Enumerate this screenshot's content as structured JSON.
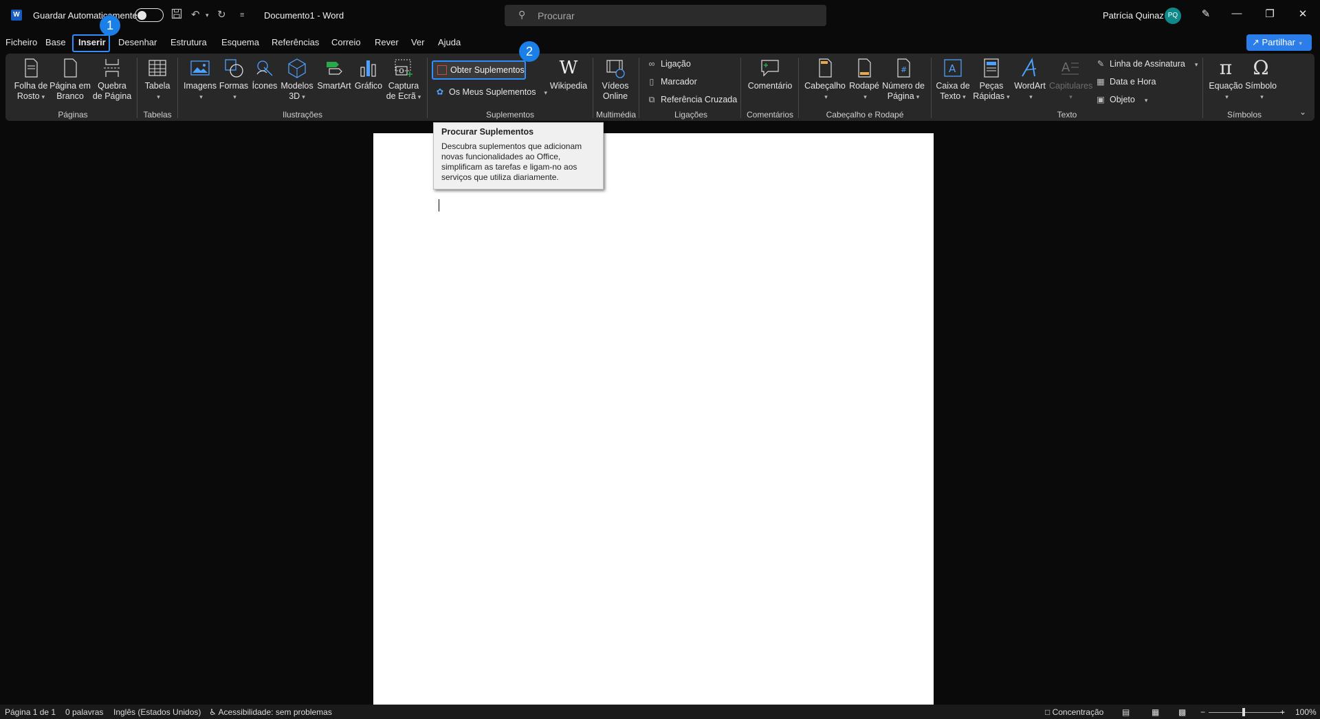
{
  "titlebar": {
    "autosave_label": "Guardar Automaticamente",
    "doc_title": "Documento1  -  Word",
    "search_placeholder": "Procurar",
    "user_name": "Patrícia Quinaz",
    "user_initials": "PQ",
    "app_badge": "W"
  },
  "tabs": [
    "Ficheiro",
    "Base",
    "Inserir",
    "Desenhar",
    "Estrutura",
    "Esquema",
    "Referências",
    "Correio",
    "Rever",
    "Ver",
    "Ajuda"
  ],
  "active_tab": "Inserir",
  "share_label": "Partilhar",
  "steps": [
    "1",
    "2"
  ],
  "ribbon": {
    "paginas": {
      "label": "Páginas",
      "folha1": "Folha de",
      "folha2": "Rosto",
      "branco1": "Página em",
      "branco2": "Branco",
      "quebra1": "Quebra",
      "quebra2": "de Página"
    },
    "tabelas": {
      "label": "Tabelas",
      "tabela": "Tabela"
    },
    "ilustracoes": {
      "label": "Ilustrações",
      "imagens": "Imagens",
      "formas": "Formas",
      "icones": "Ícones",
      "modelos1": "Modelos",
      "modelos2": "3D",
      "smartart": "SmartArt",
      "grafico": "Gráfico",
      "captura1": "Captura",
      "captura2": "de Ecrã"
    },
    "suplementos": {
      "label": "Suplementos",
      "obter": "Obter Suplementos",
      "meus": "Os Meus Suplementos",
      "wikipedia": "Wikipedia"
    },
    "multimedia": {
      "label": "Multimédia",
      "videos1": "Vídeos",
      "videos2": "Online"
    },
    "ligacoes": {
      "label": "Ligações",
      "ligacao": "Ligação",
      "marcador": "Marcador",
      "referencia": "Referência Cruzada"
    },
    "comentarios": {
      "label": "Comentários",
      "comentario": "Comentário"
    },
    "cabecalho_rodape": {
      "label": "Cabeçalho e Rodapé",
      "cabecalho": "Cabeçalho",
      "rodape": "Rodapé",
      "numero1": "Número de",
      "numero2": "Página"
    },
    "texto": {
      "label": "Texto",
      "caixa1": "Caixa de",
      "caixa2": "Texto",
      "pecas1": "Peças",
      "pecas2": "Rápidas",
      "wordart": "WordArt",
      "capitulares": "Capitulares",
      "linha": "Linha de Assinatura",
      "data": "Data e Hora",
      "objeto": "Objeto"
    },
    "simbolos": {
      "label": "Símbolos",
      "equacao": "Equação",
      "simbolo": "Símbolo"
    }
  },
  "tooltip": {
    "title": "Procurar Suplementos",
    "body": "Descubra suplementos que adicionam novas funcionalidades ao Office, simplificam as tarefas e ligam-no aos serviços que utiliza diariamente."
  },
  "statusbar": {
    "page": "Página 1 de 1",
    "words": "0 palavras",
    "language": "Inglês (Estados Unidos)",
    "accessibility": "Acessibilidade: sem problemas",
    "focus": "Concentração",
    "zoom": "100%"
  },
  "colors": {
    "accent": "#2f8fff",
    "share": "#2b7de9",
    "avatar": "#0e8a8a",
    "word_blue": "#185abd"
  }
}
